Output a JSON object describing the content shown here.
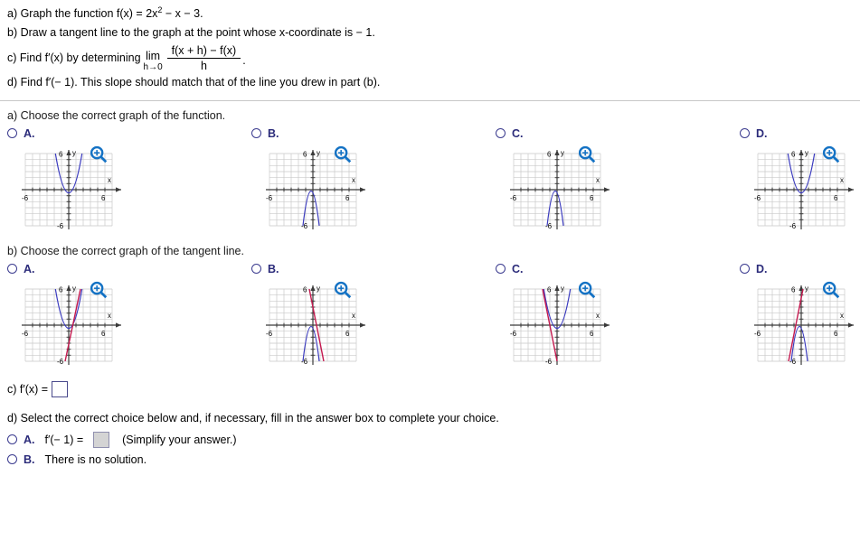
{
  "problem": {
    "line_a": "a) Graph the function f(x) = 2x",
    "line_a_exp": "2",
    "line_a_rest": " − x − 3.",
    "line_b": "b) Draw a tangent line to the graph at the point whose x-coordinate is  − 1.",
    "line_c_prefix": "c) Find f′(x) by determining",
    "lim_label": "lim",
    "lim_sub": "h→0",
    "frac_num": "f(x + h) − f(x)",
    "frac_den": "h",
    "line_c_suffix": ".",
    "line_d": "d) Find f′(− 1). This slope should match that of the line you drew in part (b)."
  },
  "part_a": {
    "prompt": "a) Choose the correct graph of the function.",
    "choices": [
      {
        "letter": "A.",
        "zoom_icon": "magnifier-plus-icon"
      },
      {
        "letter": "B.",
        "zoom_icon": "magnifier-plus-icon"
      },
      {
        "letter": "C.",
        "zoom_icon": "magnifier-plus-icon"
      },
      {
        "letter": "D.",
        "zoom_icon": "magnifier-plus-icon"
      }
    ]
  },
  "part_b": {
    "prompt": "b) Choose the correct graph of the tangent line.",
    "choices": [
      {
        "letter": "A.",
        "zoom_icon": "magnifier-plus-icon"
      },
      {
        "letter": "B.",
        "zoom_icon": "magnifier-plus-icon"
      },
      {
        "letter": "C.",
        "zoom_icon": "magnifier-plus-icon"
      },
      {
        "letter": "D.",
        "zoom_icon": "magnifier-plus-icon"
      }
    ]
  },
  "part_c": {
    "label": "c) f′(x) =",
    "value": ""
  },
  "part_d": {
    "prompt": "d) Select the correct choice below and, if necessary, fill in the answer box to complete your choice.",
    "choice_a_letter": "A.",
    "choice_a_label": "f′(− 1) =",
    "choice_a_value": "",
    "choice_a_hint": "(Simplify your answer.)",
    "choice_b_letter": "B.",
    "choice_b_label": "There is no solution."
  },
  "axes": {
    "x_label": "x",
    "y_label": "y",
    "x_min_tick": "-6",
    "x_max_tick": "6",
    "y_max_tick": "6",
    "y_min_tick": "-6"
  },
  "colors": {
    "curve": "#3b3bbf",
    "tangent": "#c4194f",
    "grid": "#c9c9c9",
    "axis": "#3a3a3a",
    "choice_letter": "#2b2b7a",
    "radio_border": "#3b3b8f",
    "zoom_icon": "#1472c4"
  },
  "chart_data": [
    {
      "id": "a-A",
      "type": "line",
      "title": "Upward parabola, vertex near (0.25, -3.1)",
      "xlim": [
        -6.5,
        6.5
      ],
      "ylim": [
        -6.5,
        6.5
      ],
      "grid": true,
      "series": [
        {
          "name": "f(x) = 2x^2 - x - 3",
          "color": "#3b3bbf",
          "kind": "parabola",
          "a": 2,
          "b": -1,
          "c": -3
        }
      ],
      "xlabel": "x",
      "ylabel": "y",
      "xticks": [
        -6,
        6
      ],
      "yticks": [
        -6,
        6
      ]
    },
    {
      "id": "a-B",
      "type": "line",
      "title": "Downward parabola, vertex near (-0.25, 1.1)",
      "xlim": [
        -6.5,
        6.5
      ],
      "ylim": [
        -6.5,
        6.5
      ],
      "grid": true,
      "series": [
        {
          "name": "-2x^2 - x + 1",
          "color": "#3b3bbf",
          "kind": "parabola",
          "a": -2,
          "b": -1,
          "c": 1
        }
      ],
      "xlabel": "x",
      "ylabel": "y",
      "xticks": [
        -6,
        6
      ],
      "yticks": [
        -6,
        6
      ]
    },
    {
      "id": "a-C",
      "type": "line",
      "title": "Downward parabola, vertex near (-0.25, 1.1)",
      "xlim": [
        -6.5,
        6.5
      ],
      "ylim": [
        -6.5,
        6.5
      ],
      "grid": true,
      "series": [
        {
          "name": "-2x^2 - x + 1",
          "color": "#3b3bbf",
          "kind": "parabola",
          "a": -2,
          "b": -1,
          "c": 1
        }
      ],
      "xlabel": "x",
      "ylabel": "y",
      "xticks": [
        -6,
        6
      ],
      "yticks": [
        -6,
        6
      ]
    },
    {
      "id": "a-D",
      "type": "line",
      "title": "Upward parabola, vertex near (0.25, -3.1)",
      "xlim": [
        -6.5,
        6.5
      ],
      "ylim": [
        -6.5,
        6.5
      ],
      "grid": true,
      "series": [
        {
          "name": "2x^2 - x - 3",
          "color": "#3b3bbf",
          "kind": "parabola",
          "a": 2,
          "b": -1,
          "c": -3
        }
      ],
      "xlabel": "x",
      "ylabel": "y",
      "xticks": [
        -6,
        6
      ],
      "yticks": [
        -6,
        6
      ]
    },
    {
      "id": "b-A",
      "type": "line",
      "title": "Upward parabola with tangent line of positive slope 5 through (-1,0)",
      "xlim": [
        -6.5,
        6.5
      ],
      "ylim": [
        -6.5,
        6.5
      ],
      "grid": true,
      "series": [
        {
          "name": "2x^2 - x - 3",
          "color": "#3b3bbf",
          "kind": "parabola",
          "a": 2,
          "b": -1,
          "c": -3
        },
        {
          "name": "tangent",
          "color": "#c4194f",
          "kind": "line",
          "slope": 5,
          "intercept": 5
        }
      ],
      "xlabel": "x",
      "ylabel": "y",
      "xticks": [
        -6,
        6
      ],
      "yticks": [
        -6,
        6
      ]
    },
    {
      "id": "b-B",
      "type": "line",
      "title": "Downward parabola with tangent line of negative slope",
      "xlim": [
        -6.5,
        6.5
      ],
      "ylim": [
        -6.5,
        6.5
      ],
      "grid": true,
      "series": [
        {
          "name": "-2x^2 - x + 1",
          "color": "#3b3bbf",
          "kind": "parabola",
          "a": -2,
          "b": -1,
          "c": 1
        },
        {
          "name": "tangent",
          "color": "#c4194f",
          "kind": "line",
          "slope": -10,
          "intercept": -1
        }
      ],
      "xlabel": "x",
      "ylabel": "y",
      "xticks": [
        -6,
        6
      ],
      "yticks": [
        -6,
        6
      ]
    },
    {
      "id": "b-C",
      "type": "line",
      "title": "Upward parabola with tangent line of negative slope",
      "xlim": [
        -6.5,
        6.5
      ],
      "ylim": [
        -6.5,
        6.5
      ],
      "grid": true,
      "series": [
        {
          "name": "2x^2 - x - 3",
          "color": "#3b3bbf",
          "kind": "parabola",
          "a": 2,
          "b": -1,
          "c": -3
        },
        {
          "name": "tangent",
          "color": "#c4194f",
          "kind": "line",
          "slope": -5,
          "intercept": -5
        }
      ],
      "xlabel": "x",
      "ylabel": "y",
      "xticks": [
        -6,
        6
      ],
      "yticks": [
        -6,
        6
      ]
    },
    {
      "id": "b-D",
      "type": "line",
      "title": "Downward parabola with tangent line of positive slope",
      "xlim": [
        -6.5,
        6.5
      ],
      "ylim": [
        -6.5,
        6.5
      ],
      "grid": true,
      "series": [
        {
          "name": "-2x^2 - x + 1",
          "color": "#3b3bbf",
          "kind": "parabola",
          "a": -2,
          "b": -1,
          "c": 1
        },
        {
          "name": "tangent",
          "color": "#c4194f",
          "kind": "line",
          "slope": 10,
          "intercept": 7
        }
      ],
      "xlabel": "x",
      "ylabel": "y",
      "xticks": [
        -6,
        6
      ],
      "yticks": [
        -6,
        6
      ]
    }
  ]
}
